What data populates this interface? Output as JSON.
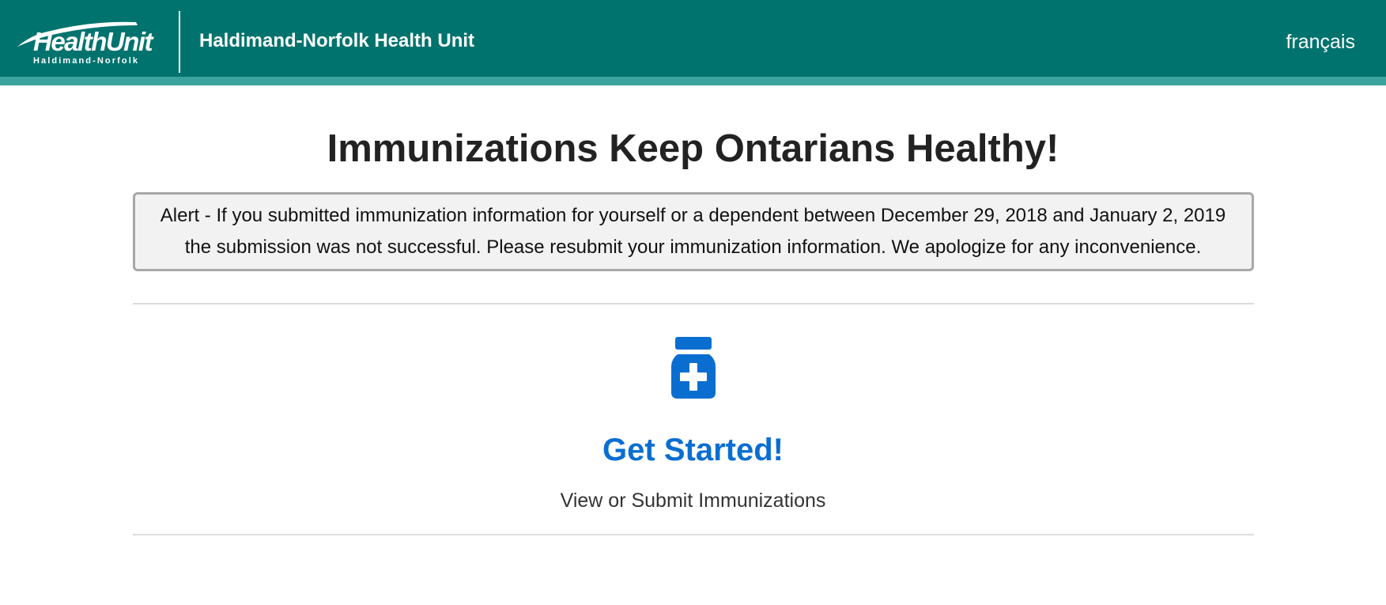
{
  "header": {
    "logo": {
      "main_text": "HealthUnit",
      "sub_text": "Haldimand-Norfolk"
    },
    "site_title": "Haldimand-Norfolk Health Unit",
    "language_link": "français",
    "colors": {
      "header_bg": "#00736e",
      "stripe": "#3ba39d"
    }
  },
  "main": {
    "title": "Immunizations Keep Ontarians Healthy!",
    "alert": {
      "text": "Alert - If you submitted immunization information for yourself or a dependent between December 29, 2018 and January 2, 2019 the submission was not successful. Please resubmit your immunization information. We apologize for any inconvenience."
    },
    "get_started": {
      "icon": "medicine-bottle-icon",
      "link_label": "Get Started!",
      "description": "View or Submit Immunizations",
      "accent_color": "#0a6ed1"
    }
  }
}
